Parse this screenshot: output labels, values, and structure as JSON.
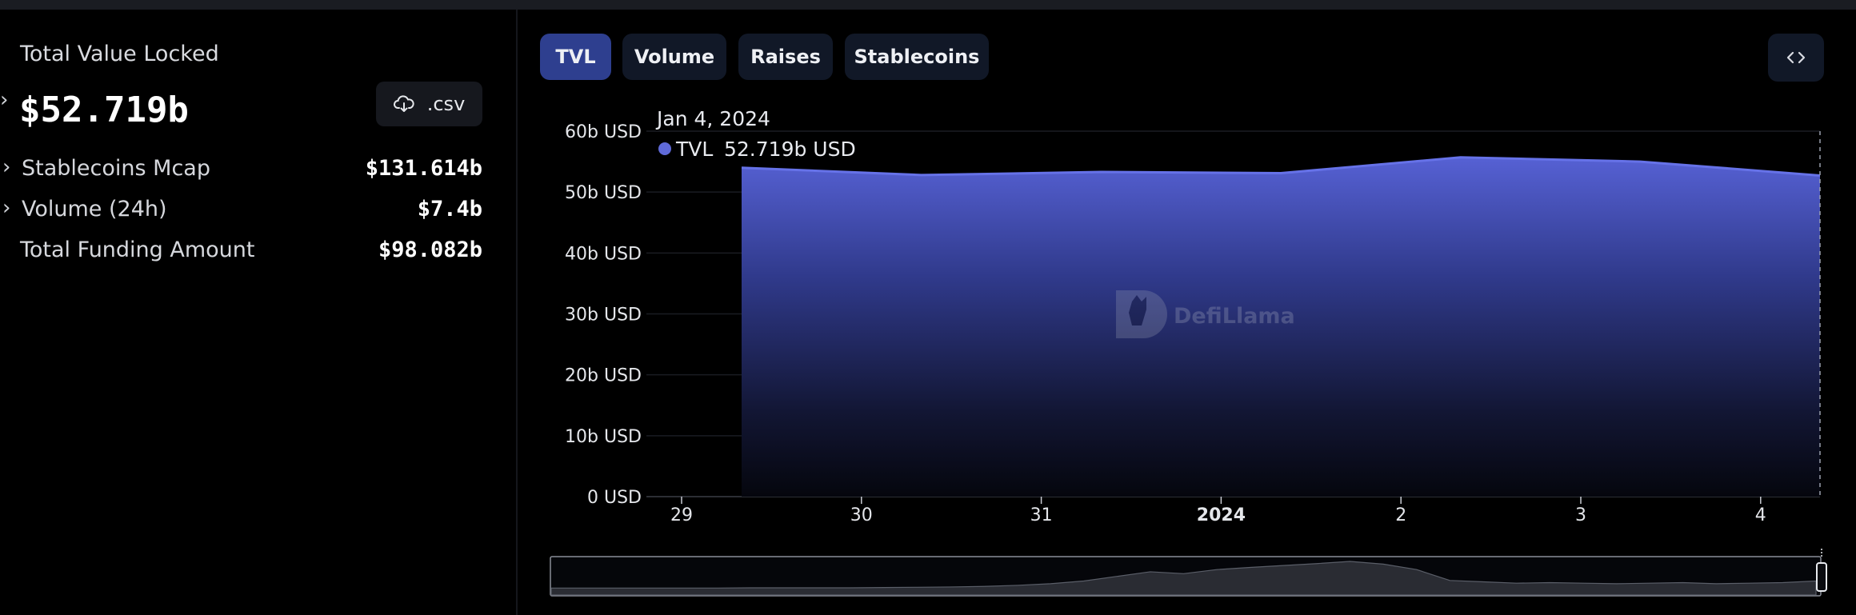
{
  "stats": {
    "tvl_label": "Total Value Locked",
    "tvl_value": "$52.719b",
    "csv_label": ".csv",
    "rows": [
      {
        "label": "Stablecoins Mcap",
        "value": "$131.614b"
      },
      {
        "label": "Volume (24h)",
        "value": "$7.4b"
      },
      {
        "label": "Total Funding Amount",
        "value": "$98.082b"
      }
    ]
  },
  "tabs": [
    {
      "label": "TVL",
      "active": true
    },
    {
      "label": "Volume",
      "active": false
    },
    {
      "label": "Raises",
      "active": false
    },
    {
      "label": "Stablecoins",
      "active": false
    }
  ],
  "watermark": "DefiLlama",
  "tooltip": {
    "date": "Jan 4, 2024",
    "series": "TVL",
    "value": "52.719b USD"
  },
  "colors": {
    "accent": "#5f6ad8",
    "line": "#6672e8",
    "active_tab": "#2e3f8f",
    "tab": "#111827"
  },
  "chart_data": {
    "type": "area",
    "x_ticks": [
      "29",
      "30",
      "31",
      "2024",
      "2",
      "3",
      "4"
    ],
    "y_ticks": [
      "0 USD",
      "10b USD",
      "20b USD",
      "30b USD",
      "40b USD",
      "50b USD",
      "60b USD"
    ],
    "ylim": [
      0,
      60
    ],
    "x": [
      "2023-12-29",
      "2023-12-30",
      "2023-12-31",
      "2024-01-01",
      "2024-01-02",
      "2024-01-03",
      "2024-01-04"
    ],
    "series": [
      {
        "name": "TVL",
        "values": [
          54.0,
          52.8,
          53.3,
          53.1,
          55.7,
          55.0,
          52.719
        ]
      }
    ],
    "grid": true,
    "legend": "none",
    "brush_overview": [
      0.02,
      0.02,
      0.02,
      0.02,
      0.02,
      0.02,
      0.03,
      0.03,
      0.03,
      0.03,
      0.04,
      0.05,
      0.06,
      0.08,
      0.12,
      0.18,
      0.28,
      0.45,
      0.62,
      0.55,
      0.7,
      0.78,
      0.85,
      0.92,
      1.0,
      0.9,
      0.7,
      0.3,
      0.25,
      0.2,
      0.22,
      0.2,
      0.18,
      0.2,
      0.22,
      0.18,
      0.2,
      0.22,
      0.28
    ]
  }
}
